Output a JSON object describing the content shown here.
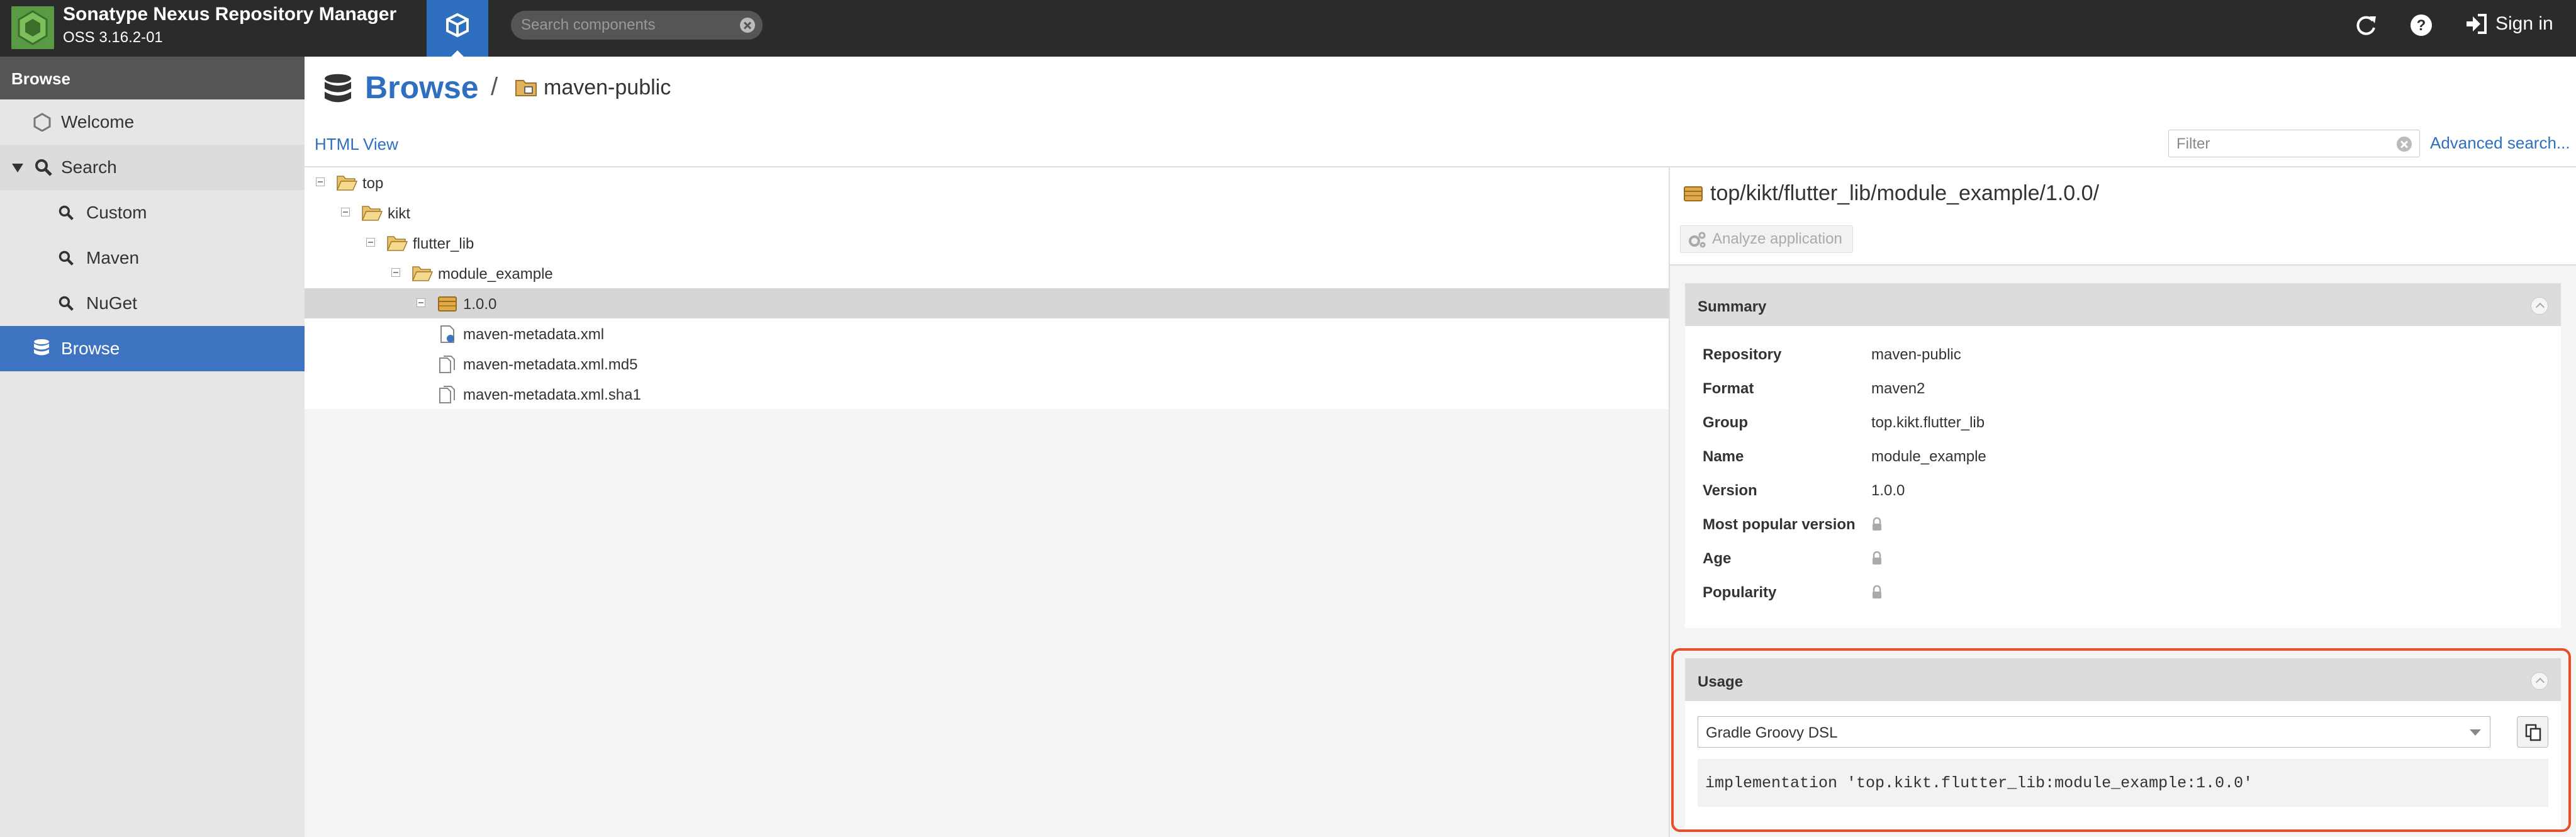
{
  "header": {
    "app_title": "Sonatype Nexus Repository Manager",
    "app_version": "OSS 3.16.2-01",
    "search_placeholder": "Search components",
    "sign_in": "Sign in",
    "accent_color": "#2f6fc0"
  },
  "sidebar": {
    "header": "Browse",
    "items": [
      {
        "label": "Welcome",
        "icon": "hexagon-icon"
      },
      {
        "label": "Search",
        "icon": "search-icon",
        "expanded": true
      },
      {
        "label": "Custom",
        "icon": "search-icon"
      },
      {
        "label": "Maven",
        "icon": "search-icon"
      },
      {
        "label": "NuGet",
        "icon": "search-icon"
      },
      {
        "label": "Browse",
        "icon": "database-icon",
        "active": true
      }
    ]
  },
  "main": {
    "title": "Browse",
    "breadcrumb_separator": "/",
    "repository": "maven-public",
    "html_view": "HTML View",
    "filter_placeholder": "Filter",
    "advanced_search": "Advanced search..."
  },
  "tree": {
    "nodes": [
      {
        "label": "top",
        "type": "folder-open"
      },
      {
        "label": "kikt",
        "type": "folder-open"
      },
      {
        "label": "flutter_lib",
        "type": "folder-open"
      },
      {
        "label": "module_example",
        "type": "folder-open"
      },
      {
        "label": "1.0.0",
        "type": "component",
        "selected": true
      },
      {
        "label": "maven-metadata.xml",
        "type": "xml-file"
      },
      {
        "label": "maven-metadata.xml.md5",
        "type": "file"
      },
      {
        "label": "maven-metadata.xml.sha1",
        "type": "file"
      }
    ]
  },
  "detail": {
    "path": "top/kikt/flutter_lib/module_example/1.0.0/",
    "analyze_button": "Analyze application",
    "summary": {
      "title": "Summary",
      "rows": [
        {
          "key": "Repository",
          "value": "maven-public"
        },
        {
          "key": "Format",
          "value": "maven2"
        },
        {
          "key": "Group",
          "value": "top.kikt.flutter_lib"
        },
        {
          "key": "Name",
          "value": "module_example"
        },
        {
          "key": "Version",
          "value": "1.0.0"
        },
        {
          "key": "Most popular version",
          "value": "",
          "locked": true
        },
        {
          "key": "Age",
          "value": "",
          "locked": true
        },
        {
          "key": "Popularity",
          "value": "",
          "locked": true
        }
      ]
    },
    "usage": {
      "title": "Usage",
      "selected_format": "Gradle Groovy DSL",
      "code": "implementation 'top.kikt.flutter_lib:module_example:1.0.0'",
      "highlight_color": "#e5502a"
    }
  }
}
